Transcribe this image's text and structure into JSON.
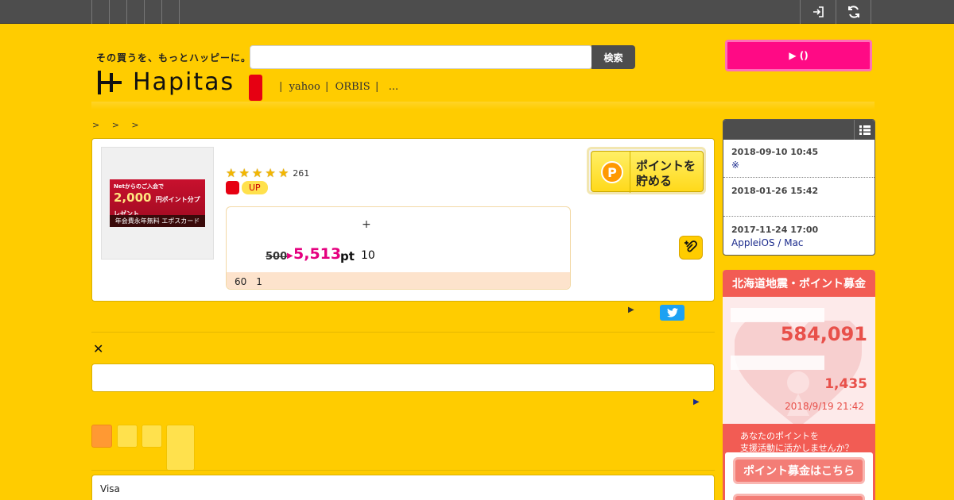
{
  "header": {
    "tagline": "その買うを、もっとハッピーに。",
    "logo_text": "Hapitas",
    "search_placeholder": "",
    "search_button": "検索",
    "keywords": [
      {
        "sep": "|",
        "label": "yahoo"
      },
      {
        "sep": "|",
        "label": "ORBIS"
      },
      {
        "sep": "|",
        "label": "..."
      }
    ],
    "cta_button": "▶ ()"
  },
  "breadcrumb": "> > >",
  "product": {
    "banner": {
      "line1": "Netからのご入会で",
      "line2_num": "2,000",
      "line2_suffix": "円ポイント分プレゼント",
      "line3": "年会費永年無料 エポスカード"
    },
    "rating_stars": 5,
    "review_count": "261",
    "up_badge": "UP",
    "plus": "+",
    "old_points": "500",
    "points": "5,513",
    "points_unit": "pt",
    "multiplier": "10",
    "footer_text": "60　1",
    "save_button": "ポイントを\n貯める"
  },
  "share": {
    "twitter_icon": "twitter-bird"
  },
  "close_label": "✕",
  "next_arrow": "▶",
  "payment_label": "Visa",
  "news": {
    "items": [
      {
        "date": "2018-09-10 10:45",
        "desc": "※"
      },
      {
        "date": "2018-01-26 15:42",
        "desc": ""
      },
      {
        "date": "2017-11-24 17:00",
        "desc": "AppleiOS / Mac"
      }
    ]
  },
  "donation": {
    "title": "北海道地震・ポイント募金",
    "total_points": "584,091",
    "donors": "1,435",
    "updated": "2018/9/19 21:42",
    "ask": "あなたのポイントを\n支援活動に活かしませんか？",
    "button": "ポイント募金はこちら"
  },
  "colors": {
    "background": "#ffcc00",
    "accent_pink": "#ff0a85",
    "points_pink": "#e5007f",
    "donation_red": "#f25c54"
  }
}
